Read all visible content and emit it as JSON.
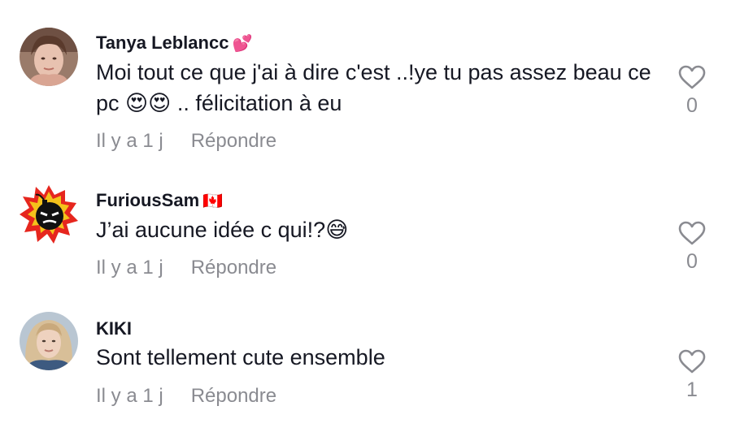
{
  "comments": [
    {
      "username": "Tanya Leblancc",
      "username_suffix": "💕",
      "text": "Moi tout ce que j'ai à dire c'est ..!ye tu pas assez beau ce pc 😍😍 .. félicitation à eu",
      "time": "Il y a 1 j",
      "reply_label": "Répondre",
      "likes": "0"
    },
    {
      "username": "FuriousSam",
      "username_suffix": "🇨🇦",
      "text": "J’ai aucune idée c qui!?😅",
      "time": "Il y a 1 j",
      "reply_label": "Répondre",
      "likes": "0"
    },
    {
      "username": "KIKI",
      "username_suffix": "",
      "text": "Sont tellement cute ensemble",
      "time": "Il y a 1 j",
      "reply_label": "Répondre",
      "likes": "1"
    }
  ],
  "icons": {
    "like": "heart-outline-icon",
    "avatar_2": "bomb-avatar-icon"
  },
  "colors": {
    "text": "#161823",
    "muted": "#8a8b91",
    "heart_outline": "#8a8b91"
  }
}
